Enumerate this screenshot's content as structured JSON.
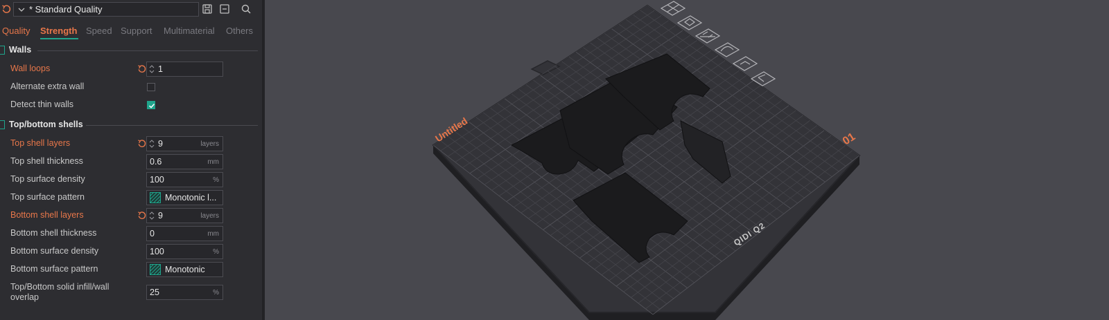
{
  "preset": {
    "name": "* Standard Quality",
    "icons": [
      "reset-icon",
      "chevron-down-icon",
      "save-icon",
      "collapse-icon",
      "search-icon"
    ]
  },
  "tabs": [
    {
      "label": "Quality",
      "state": "modified"
    },
    {
      "label": "Strength",
      "state": "active"
    },
    {
      "label": "Speed",
      "state": "normal"
    },
    {
      "label": "Support",
      "state": "normal"
    },
    {
      "label": "Multimaterial",
      "state": "normal"
    },
    {
      "label": "Others",
      "state": "normal"
    }
  ],
  "walls": {
    "title": "Walls",
    "wall_loops": {
      "label": "Wall loops",
      "value": "1"
    },
    "alternate_extra_wall": {
      "label": "Alternate extra wall",
      "checked": false
    },
    "detect_thin_walls": {
      "label": "Detect thin walls",
      "checked": true
    }
  },
  "shells": {
    "title": "Top/bottom shells",
    "top_shell_layers": {
      "label": "Top shell layers",
      "value": "9",
      "unit": "layers"
    },
    "top_shell_thickness": {
      "label": "Top shell thickness",
      "value": "0.6",
      "unit": "mm"
    },
    "top_surface_density": {
      "label": "Top surface density",
      "value": "100",
      "unit": "%"
    },
    "top_surface_pattern": {
      "label": "Top surface pattern",
      "value": "Monotonic l..."
    },
    "bottom_shell_layers": {
      "label": "Bottom shell layers",
      "value": "9",
      "unit": "layers"
    },
    "bottom_shell_thickness": {
      "label": "Bottom shell thickness",
      "value": "0",
      "unit": "mm"
    },
    "bottom_surface_density": {
      "label": "Bottom surface density",
      "value": "100",
      "unit": "%"
    },
    "bottom_surface_pattern": {
      "label": "Bottom surface pattern",
      "value": "Monotonic"
    },
    "overlap": {
      "label_line1": "Top/Bottom solid infill/wall",
      "label_line2": "overlap",
      "value": "25",
      "unit": "%"
    }
  },
  "viewport": {
    "plate_name": "Untitled",
    "plate_number": "01",
    "printer_brand": "QIDI Q2",
    "toolbar_icons": [
      "close-icon",
      "orient-icon",
      "arrange-icon",
      "shell-icon",
      "layout-icon",
      "collapse-corner-icon"
    ],
    "colors": {
      "accent": "#e8774a",
      "teal": "#1fa58c",
      "plate": "#2e2e33",
      "part": "#1b1b1d"
    }
  }
}
